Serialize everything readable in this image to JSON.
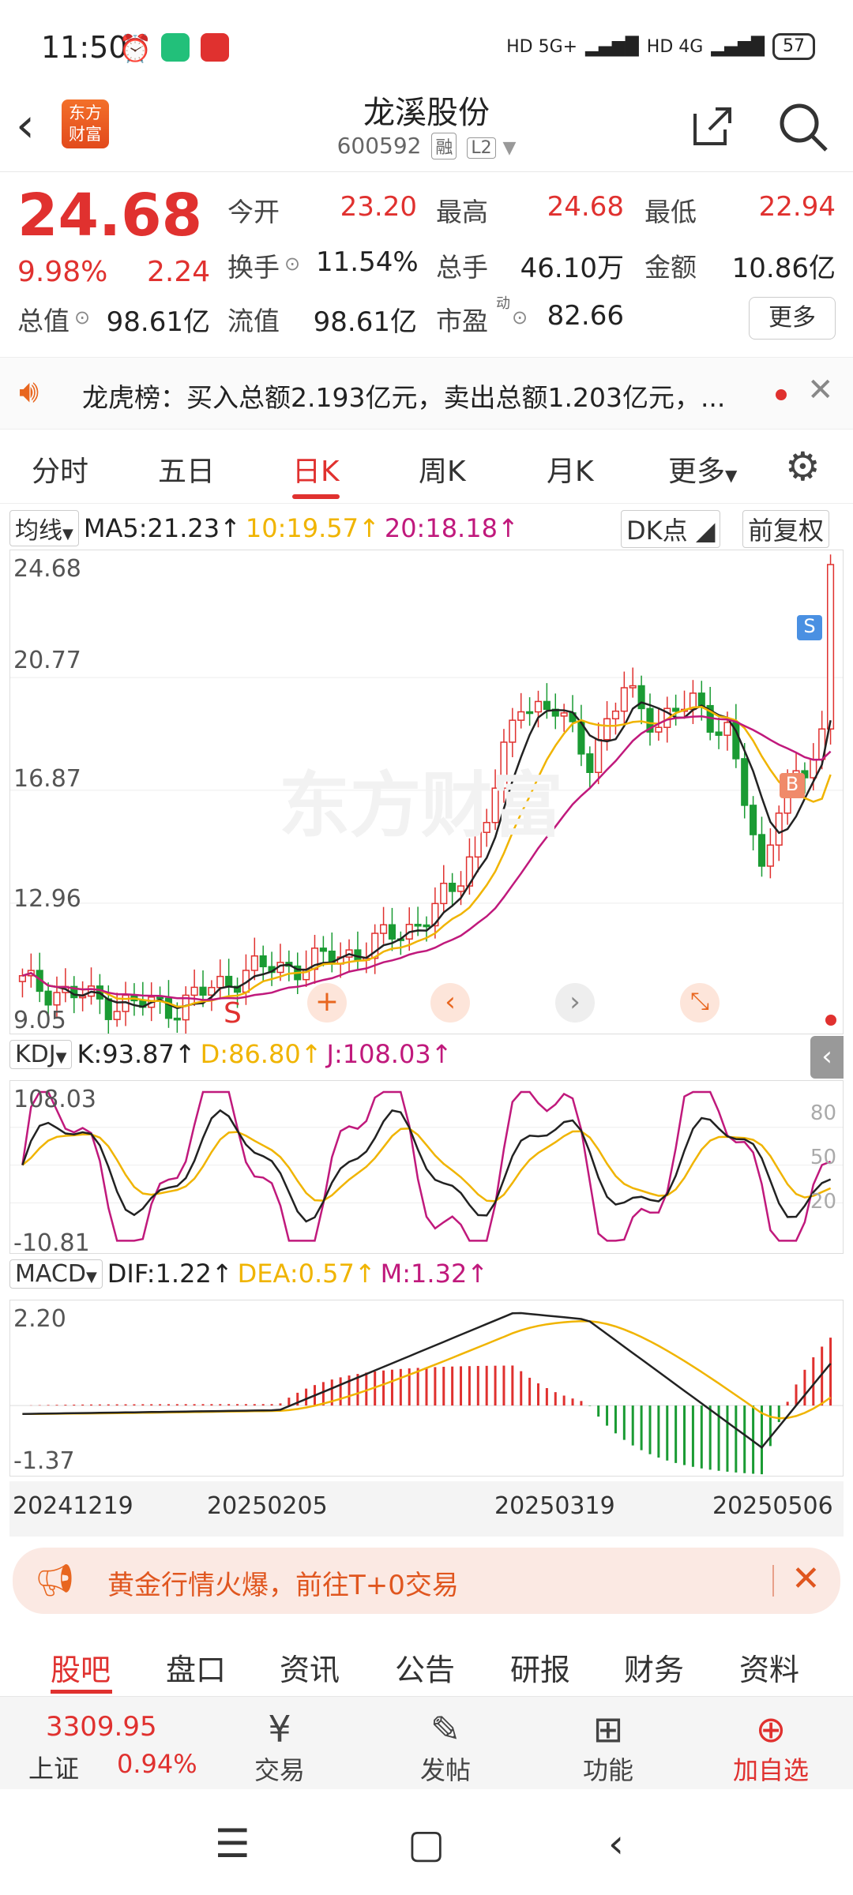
{
  "status": {
    "time": "11:50",
    "signal1": "HD 5G+",
    "signal2": "HD 4G",
    "battery": "57"
  },
  "header": {
    "logo_line1": "东方",
    "logo_line2": "财富",
    "title": "龙溪股份",
    "code": "600592",
    "tag1": "融",
    "tag2": "L2"
  },
  "quote": {
    "price": "24.68",
    "change_pct": "9.98%",
    "change": "2.24",
    "open_label": "今开",
    "open": "23.20",
    "high_label": "最高",
    "high": "24.68",
    "low_label": "最低",
    "low": "22.94",
    "turnover_label": "换手",
    "turnover": "11.54%",
    "volume_label": "总手",
    "volume": "46.10万",
    "amount_label": "金额",
    "amount": "10.86亿",
    "mcap_label": "总值",
    "mcap": "98.61亿",
    "float_label": "流值",
    "float": "98.61亿",
    "pe_label": "市盈",
    "pe_sup": "动",
    "pe": "82.66",
    "more": "更多"
  },
  "news": {
    "text": "龙虎榜：买入总额2.193亿元，卖出总额1.203亿元，..."
  },
  "tabs": [
    {
      "label": "分时"
    },
    {
      "label": "五日"
    },
    {
      "label": "日K"
    },
    {
      "label": "周K"
    },
    {
      "label": "月K"
    },
    {
      "label": "更多"
    }
  ],
  "kline": {
    "ma_select": "均线",
    "ma5": "MA5:21.23",
    "ma10": "10:19.57",
    "ma20": "20:18.18",
    "dk": "DK点",
    "adj": "前复权",
    "y_labels": [
      "24.68",
      "20.77",
      "16.87",
      "12.96",
      "9.05"
    ],
    "watermark": "东方财富",
    "up_color": "#e0312f",
    "down_color": "#1a9b33"
  },
  "kdj": {
    "select": "KDJ",
    "k": "K:93.87",
    "d": "D:86.80",
    "j": "J:108.03",
    "y_top": "108.03",
    "y_bottom": "-10.81",
    "levels": [
      "80",
      "50",
      "20"
    ]
  },
  "macd": {
    "select": "MACD",
    "dif": "DIF:1.22",
    "dea": "DEA:0.57",
    "m": "M:1.32",
    "y_top": "2.20",
    "y_bottom": "-1.37"
  },
  "dates": [
    "20241219",
    "20250205",
    "20250319",
    "20250506"
  ],
  "promo": {
    "text": "黄金行情火爆，前往T+0交易"
  },
  "bottom_tabs": [
    {
      "label": "股吧"
    },
    {
      "label": "盘口"
    },
    {
      "label": "资讯"
    },
    {
      "label": "公告"
    },
    {
      "label": "研报"
    },
    {
      "label": "财务"
    },
    {
      "label": "资料"
    }
  ],
  "toolbar": {
    "index_value": "3309.95",
    "index_name": "上证",
    "index_pct": "0.94%",
    "trade": "交易",
    "post": "发帖",
    "func": "功能",
    "watch": "加自选"
  }
}
